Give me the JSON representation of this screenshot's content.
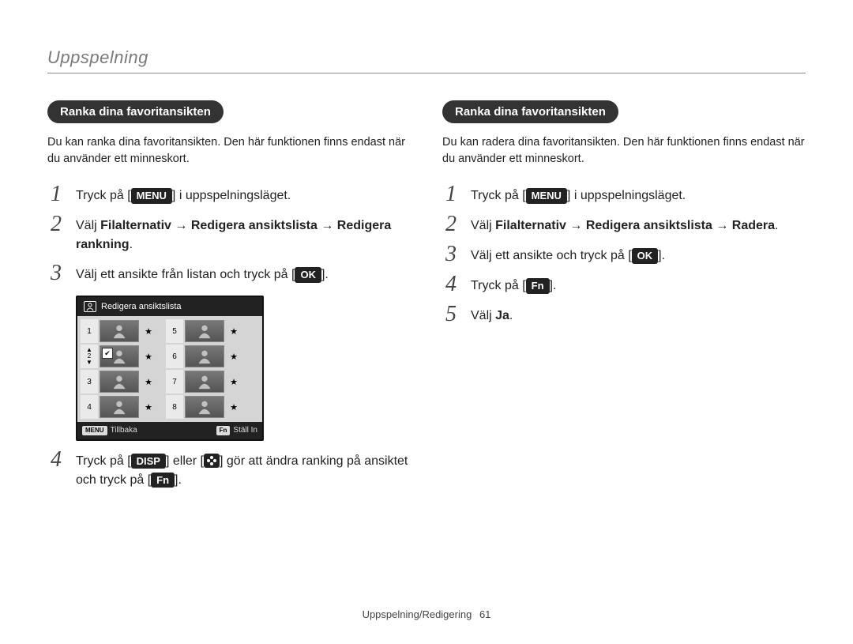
{
  "section": "Uppspelning",
  "left": {
    "heading": "Ranka dina favoritansikten",
    "intro": "Du kan ranka dina favoritansikten. Den här funktionen finns endast när du använder ett minneskort.",
    "steps": {
      "s1": {
        "pre": "Tryck på [",
        "key": "MENU",
        "post": "] i uppspelningsläget."
      },
      "s2": {
        "pre": "Välj ",
        "b1": "Filalternativ",
        "arrow1": " → ",
        "b2": "Redigera ansiktslista",
        "arrow2": " → ",
        "b3": "Redigera rankning",
        "post": "."
      },
      "s3": {
        "pre": "Välj ett ansikte från listan och tryck på [",
        "key": "OK",
        "post": "]."
      },
      "s4": {
        "pre": "Tryck på [",
        "key1": "DISP",
        "mid1": "] eller [",
        "flower": true,
        "mid2": "] gör att ändra ranking på ansiktet och tryck på [",
        "key2": "Fn",
        "post": "]."
      }
    },
    "shot": {
      "title": "Redigera ansiktslista",
      "ranks_left": [
        "1",
        "2",
        "3",
        "4"
      ],
      "ranks_right": [
        "5",
        "6",
        "7",
        "8"
      ],
      "rank2_arrows": true,
      "footer_left_key": "MENU",
      "footer_left_label": "Tillbaka",
      "footer_right_key": "Fn",
      "footer_right_label": "Ställ In"
    }
  },
  "right": {
    "heading": "Ranka dina favoritansikten",
    "intro": "Du kan radera dina favoritansikten. Den här funktionen finns endast när du använder ett minneskort.",
    "steps": {
      "s1": {
        "pre": "Tryck på [",
        "key": "MENU",
        "post": "] i uppspelningsläget."
      },
      "s2": {
        "pre": "Välj ",
        "b1": "Filalternativ",
        "arrow1": " → ",
        "b2": "Redigera ansiktslista",
        "arrow2": " → ",
        "b3": "Radera",
        "post": "."
      },
      "s3": {
        "pre": "Välj ett ansikte och tryck på [",
        "key": "OK",
        "post": "]."
      },
      "s4": {
        "pre": "Tryck på [",
        "key": "Fn",
        "post": "]."
      },
      "s5": {
        "pre": "Välj ",
        "b1": "Ja",
        "post": "."
      }
    }
  },
  "footer": {
    "label": "Uppspelning/Redigering",
    "page": "61"
  }
}
